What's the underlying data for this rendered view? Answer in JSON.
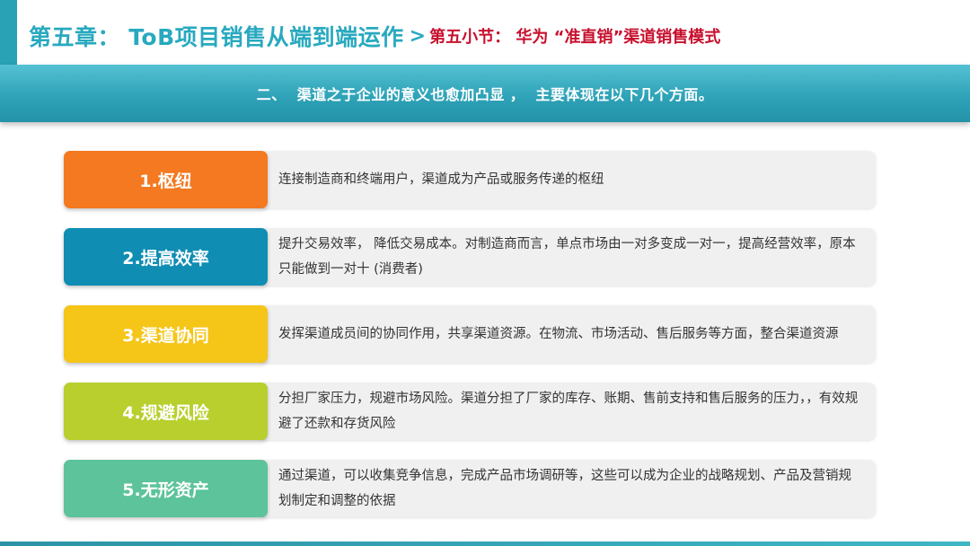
{
  "header": {
    "chapter_title": "第五章：  ToB项目销售从端到端运作",
    "separator": ">",
    "section_title": "第五小节：  华为  “准直销”渠道销售模式"
  },
  "banner": {
    "text": "二、  渠道之于企业的意义也愈加凸显 ，  主要体现在以下几个方面。"
  },
  "items": [
    {
      "label": "1.枢纽",
      "desc": "连接制造商和终端用户，渠道成为产品或服务传递的枢纽",
      "color": "#f47920"
    },
    {
      "label": "2.提高效率",
      "desc": "提升交易效率，  降低交易成本。对制造商而言，单点市场由一对多变成一对一，提高经营效率，原本只能做到一对十  (消费者)",
      "color": "#0f8db3"
    },
    {
      "label": "3.渠道协同",
      "desc": "发挥渠道成员间的协同作用，共享渠道资源。在物流、市场活动、售后服务等方面，整合渠道资源",
      "color": "#f5c518"
    },
    {
      "label": "4.规避风险",
      "desc": "分担厂家压力，规避市场风险。渠道分担了厂家的库存、账期、售前支持和售后服务的压力，，有效规避了还款和存货风险",
      "color": "#b8cf2d"
    },
    {
      "label": "5.无形资产",
      "desc": "通过渠道，可以收集竞争信息，完成产品市场调研等，这些可以成为企业的战略规划、产品及营销规划制定和调整的依据",
      "color": "#5cc39a"
    }
  ]
}
